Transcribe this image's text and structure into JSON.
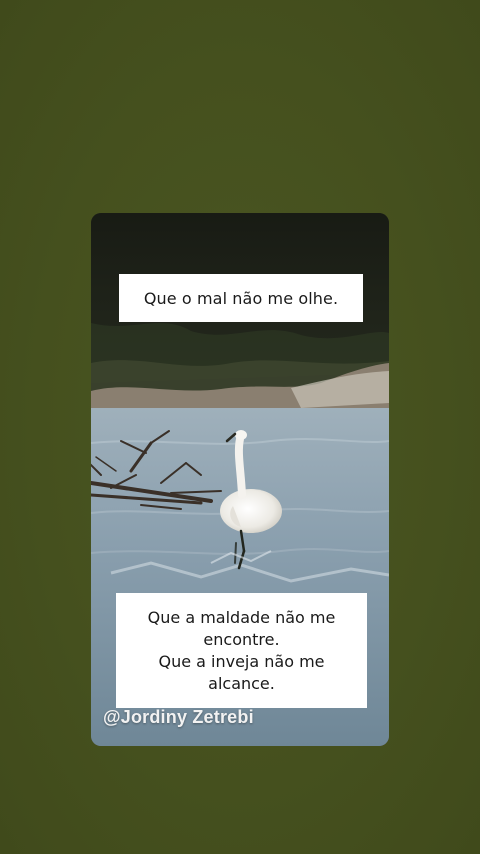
{
  "story": {
    "caption_top": "Que o mal não me olhe.",
    "caption_bottom_lines": [
      "Que a maldade não me",
      "encontre.",
      "Que a inveja não me",
      "alcance."
    ],
    "watermark": "@Jordiny Zetrebi"
  },
  "colors": {
    "background": "#47521f",
    "caption_box": "#ffffff",
    "caption_text": "#1a1a1a",
    "watermark_text": "#f2f2f2",
    "water": "#8ea3b2"
  },
  "scene": {
    "subject": "white egret standing in a river near driftwood"
  }
}
